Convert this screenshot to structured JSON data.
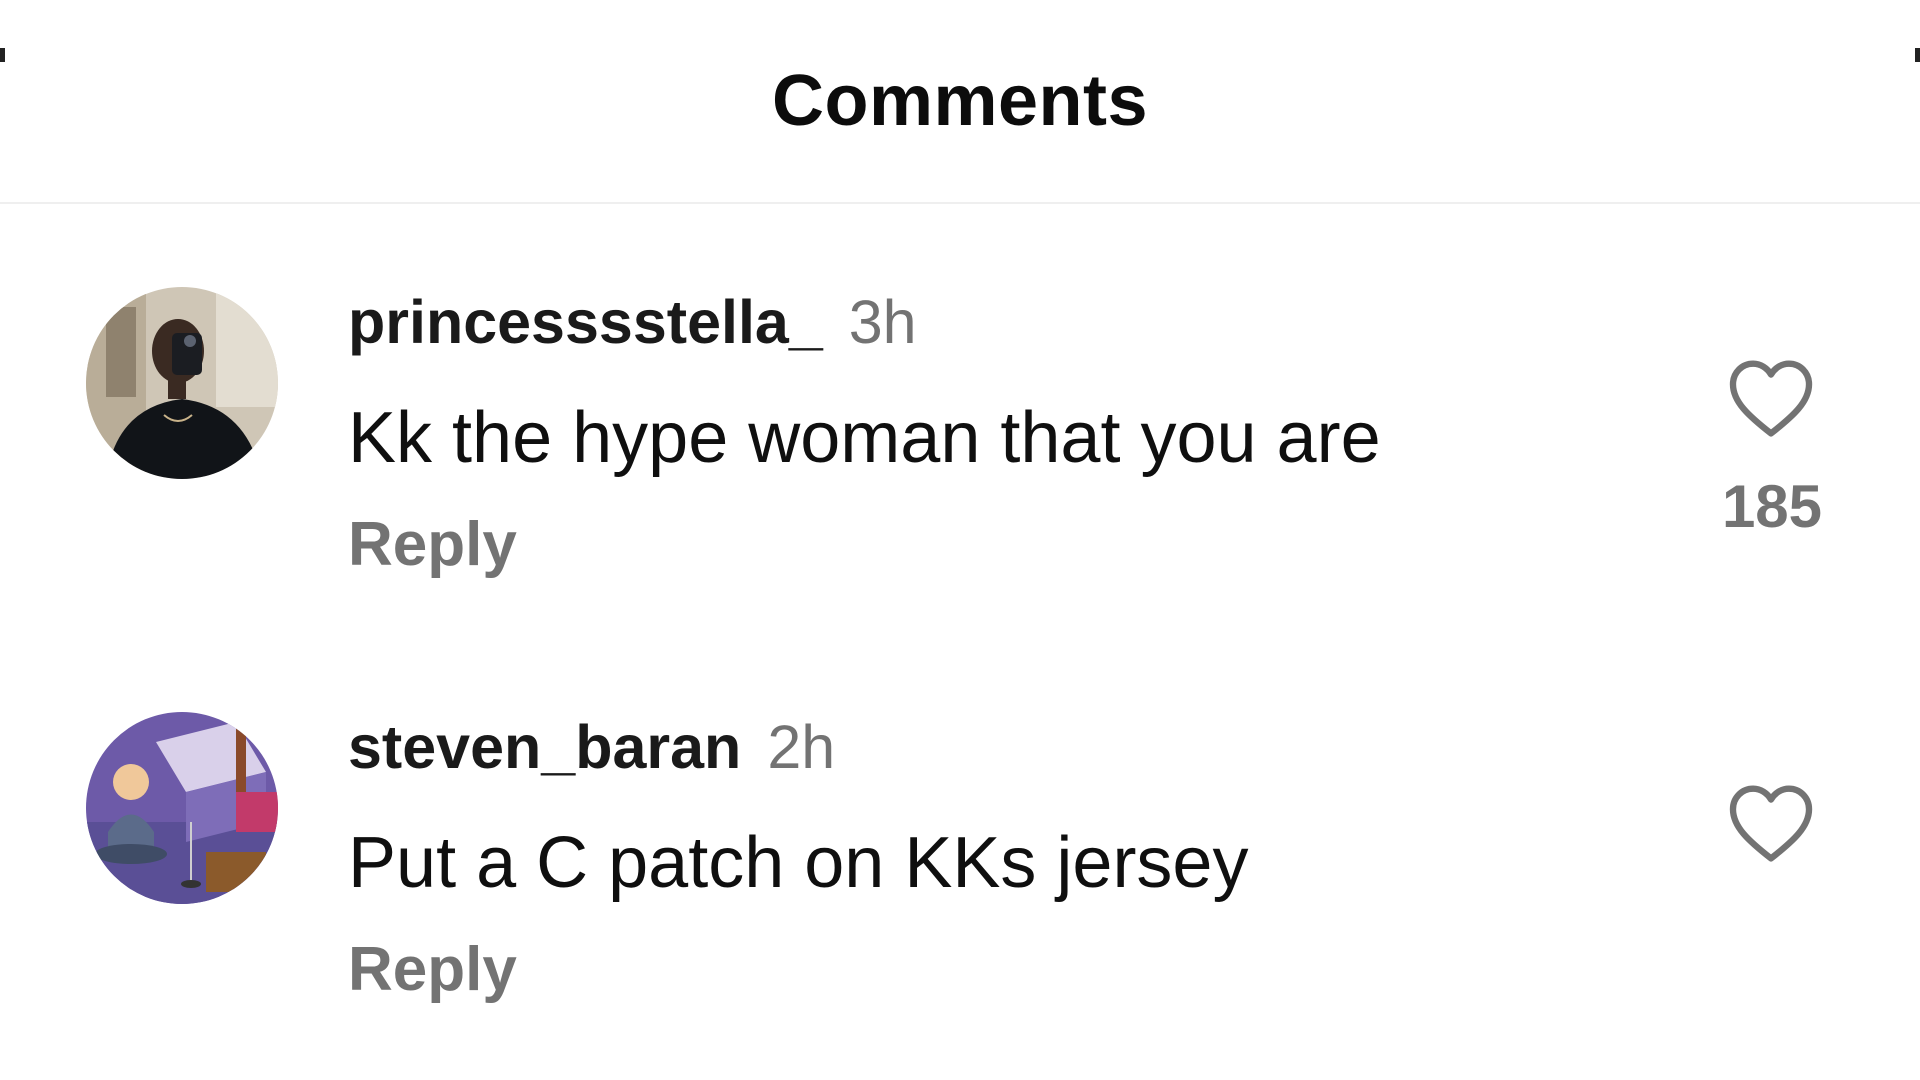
{
  "header": {
    "title": "Comments"
  },
  "comments": [
    {
      "username": "princesssstella_",
      "time": "3h",
      "text": "Kk the hype woman that you are",
      "reply_label": "Reply",
      "like_count": "185",
      "avatar": "selfie-photo-avatar"
    },
    {
      "username": "steven_baran",
      "time": "2h",
      "text": "Put a C patch on KKs jersey",
      "reply_label": "Reply",
      "like_count": "",
      "avatar": "cartoon-character-avatar"
    }
  ],
  "icons": {
    "like": "heart-outline-icon"
  },
  "colors": {
    "text_primary": "#111111",
    "text_secondary": "#737373",
    "divider": "#efefef",
    "background": "#ffffff"
  }
}
